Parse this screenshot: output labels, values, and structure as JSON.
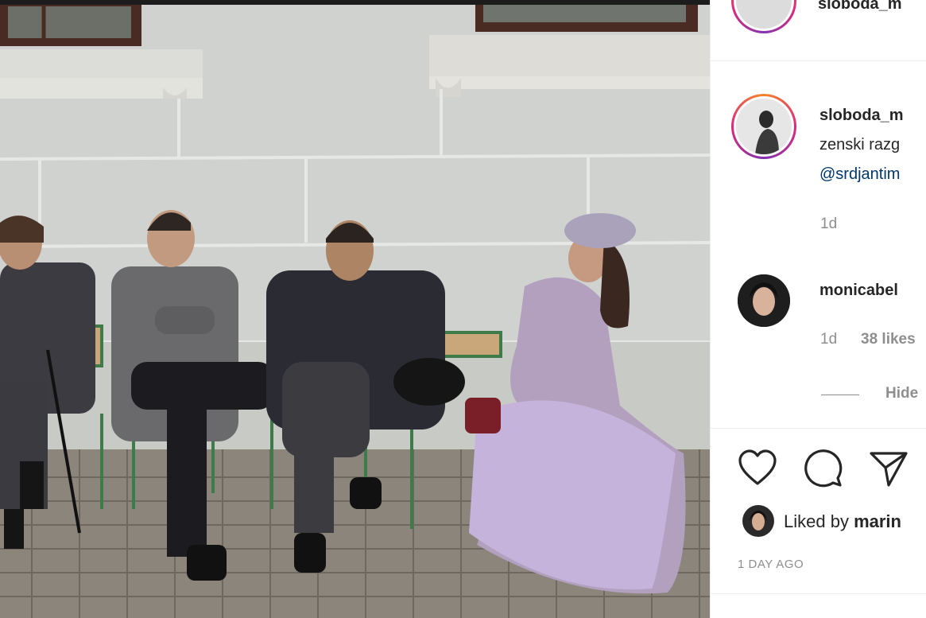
{
  "post": {
    "header_username": "sloboda_m",
    "author_username": "sloboda_m",
    "caption": "zenski razg",
    "mention": "@srdjantim",
    "caption_time": "1d"
  },
  "comments": [
    {
      "username": "monicabel",
      "time": "1d",
      "likes": "38 likes",
      "hide_label": "Hide"
    }
  ],
  "actions": {
    "like": "heart-icon",
    "comment": "comment-icon",
    "share": "share-icon"
  },
  "likes": {
    "prefix": "Liked by",
    "user": "marin"
  },
  "timestamp": "1 DAY AGO",
  "colors": {
    "mention": "#00376b",
    "meta": "#8e8e8e",
    "ring_start": "#f58529",
    "ring_end": "#dd2a7b"
  }
}
